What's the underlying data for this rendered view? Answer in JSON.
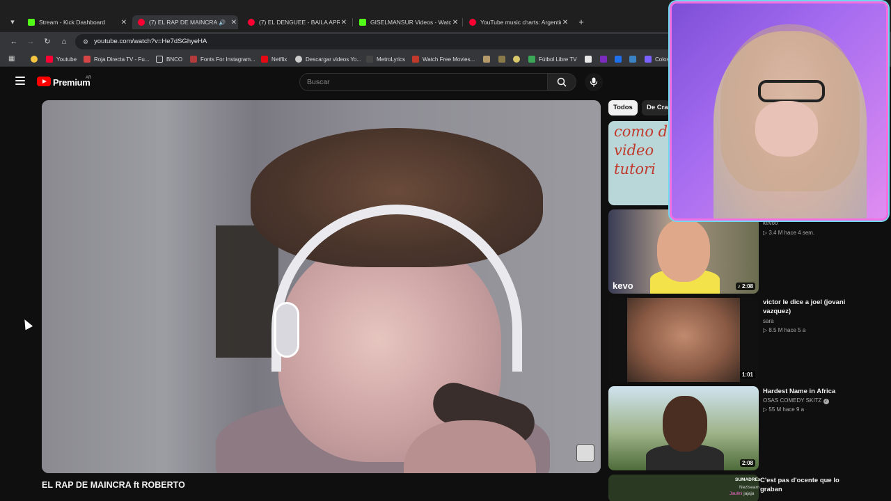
{
  "browser": {
    "tabs": [
      {
        "title": "Stream - Kick Dashboard",
        "color": "#53fc18"
      },
      {
        "title": "(7) EL RAP DE MAINCRA ft",
        "color": "#ff0033"
      },
      {
        "title": "(7) EL DENGUEE - BAILA APRET",
        "color": "#ff0033"
      },
      {
        "title": "GISELMANSUR Videos - Watch",
        "color": "#53fc18"
      },
      {
        "title": "YouTube music charts: Argentin",
        "color": "#ff0033"
      }
    ],
    "new_tab": "+",
    "url": "youtube.com/watch?v=He7dSGhyeHA",
    "bookmarks": [
      {
        "label": "",
        "color": "#f5c542"
      },
      {
        "label": "Youtube",
        "color": "#ff0033"
      },
      {
        "label": "Roja Directa TV - Fu...",
        "color": "#d64545"
      },
      {
        "label": "BNCO",
        "color": "#5f6368"
      },
      {
        "label": "Fonts For Instagram...",
        "color": "#b23b3b"
      },
      {
        "label": "Netflix",
        "color": "#e50914"
      },
      {
        "label": "Descargar videos Yo...",
        "color": "#cccccc"
      },
      {
        "label": "MetroLyrics",
        "color": "#444444"
      },
      {
        "label": "Watch Free Movies...",
        "color": "#c0392b"
      },
      {
        "label": "Fútbol Libre TV",
        "color": "#3aa857"
      },
      {
        "label": "Colos",
        "color": "#7b61ff"
      }
    ]
  },
  "youtube": {
    "brand": "Premium",
    "country": "AR",
    "search_placeholder": "Buscar",
    "video_title": "EL RAP DE MAINCRA ft ROBERTO",
    "chips": [
      "Todos",
      "De Craz"
    ],
    "thumb1_text": "como do video tutori",
    "recommendations": [
      {
        "title": "",
        "channel": "kevoo",
        "meta": "▷ 3.4 M  hace 4 sem.",
        "duration": "♪ 2:08",
        "badge": "kevo"
      },
      {
        "title": "victor le dice a joel (jovani vazquez)",
        "channel": "sara",
        "meta": "▷ 8.5 M  hace 5 a",
        "duration": "1:01"
      },
      {
        "title": "Hardest Name in Africa",
        "channel": "OSAS COMEDY SKITZ",
        "meta": "▷ 55 M  hace 9 a",
        "duration": "2:08"
      }
    ]
  },
  "chat": {
    "user1": "SUMADREx",
    "user2": "Nezlseam",
    "user3": "Jaulini",
    "user3_msg": "jajaja",
    "message": "C'est pas d'ocente que lo graban"
  }
}
